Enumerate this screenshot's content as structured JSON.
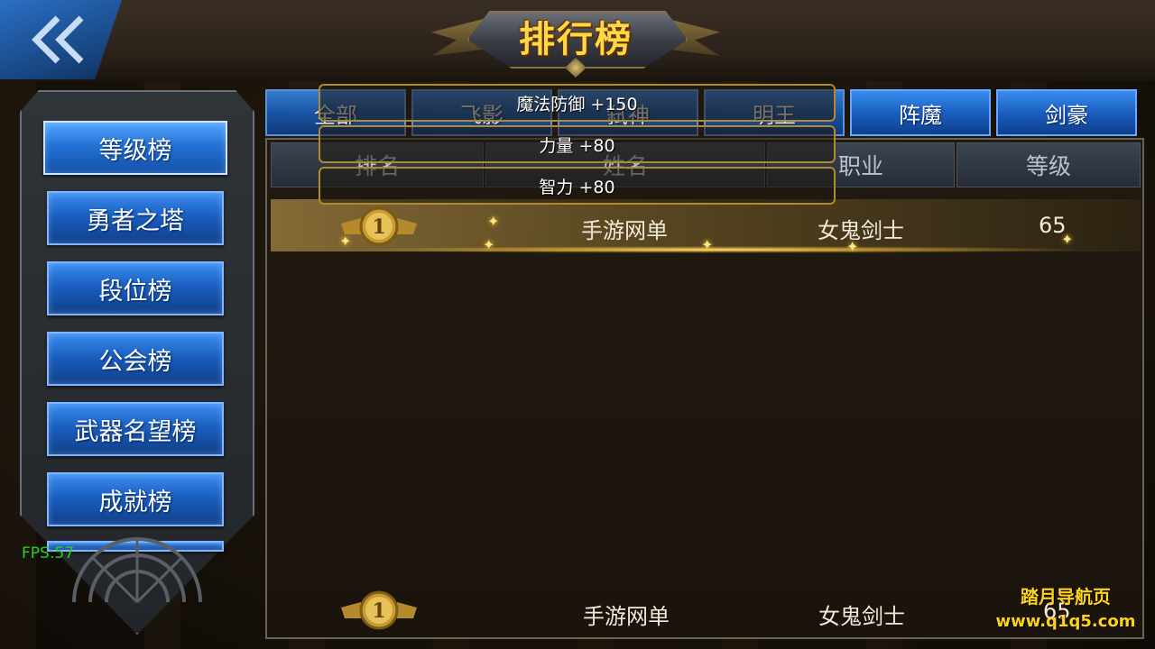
{
  "title": "排行榜",
  "fps": "FPS:57",
  "sidebar": {
    "items": [
      {
        "label": "等级榜"
      },
      {
        "label": "勇者之塔"
      },
      {
        "label": "段位榜"
      },
      {
        "label": "公会榜"
      },
      {
        "label": "武器名望榜"
      },
      {
        "label": "成就榜"
      }
    ],
    "active_index": 0
  },
  "tabs": [
    {
      "label": "全部"
    },
    {
      "label": "飞影"
    },
    {
      "label": "弑神"
    },
    {
      "label": "明王"
    },
    {
      "label": "阵魔"
    },
    {
      "label": "剑豪"
    }
  ],
  "columns": [
    "排名",
    "姓名",
    "职业",
    "等级"
  ],
  "rows": [
    {
      "rank": "1",
      "name": "手游网单",
      "class": "女鬼剑士",
      "level": "65"
    }
  ],
  "my_rank": {
    "rank": "1",
    "name": "手游网单",
    "class": "女鬼剑士",
    "level": "65"
  },
  "tooltip": {
    "lines": [
      "魔法防御 +150",
      "力量 +80",
      "智力 +80"
    ]
  },
  "watermark": {
    "line1": "踏月导航页",
    "line2": "www.q1q5.com"
  },
  "colors": {
    "accent_blue": "#1a5fc0",
    "gold": "#ffd84a",
    "fps_green": "#24d224"
  }
}
